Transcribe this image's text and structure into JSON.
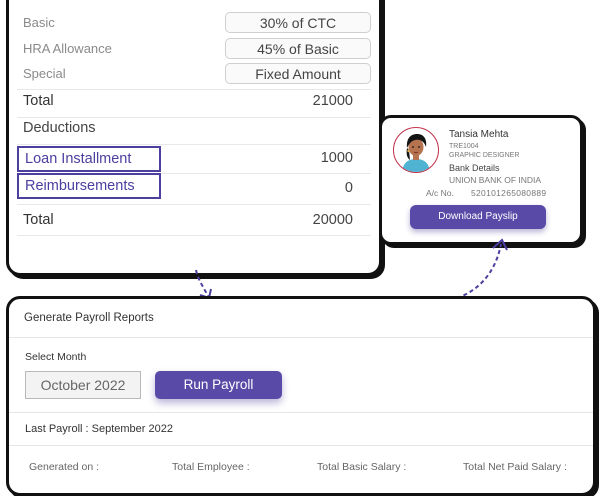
{
  "salary": {
    "rows": [
      {
        "label": "Basic",
        "value": "30% of CTC"
      },
      {
        "label": "HRA Allowance",
        "value": "45% of Basic"
      },
      {
        "label": "Special",
        "value": "Fixed Amount"
      }
    ],
    "total_label": "Total",
    "total_value": "21000",
    "deductions_label": "Deductions",
    "deductions": [
      {
        "label": "Loan Installment",
        "value": "1000"
      },
      {
        "label": "Reimbursements",
        "value": "0"
      }
    ],
    "net_total_label": "Total",
    "net_total_value": "20000"
  },
  "employee": {
    "name": "Tansia Mehta",
    "id": "TRE1004",
    "role": "GRAPHIC DESIGNER",
    "bank_title": "Bank Details",
    "bank": "UNION BANK OF INDIA",
    "account_label": "A/c No.",
    "account_no": "520101265080889",
    "download_label": "Download Payslip"
  },
  "payroll": {
    "title": "Generate Payroll Reports",
    "select_label": "Select Month",
    "month_value": "October 2022",
    "run_label": "Run Payroll",
    "last_payroll": "Last Payroll : September 2022",
    "columns": [
      "Generated on :",
      "Total Employee :",
      "Total Basic Salary :",
      "Total Net Paid Salary :"
    ]
  },
  "colors": {
    "accent": "#5a4aa8",
    "highlight_border": "#4b3fa0",
    "card_border": "#111111"
  },
  "icons": {
    "avatar": "woman-avatar-icon",
    "connector": "dashed-arrow-icon"
  }
}
